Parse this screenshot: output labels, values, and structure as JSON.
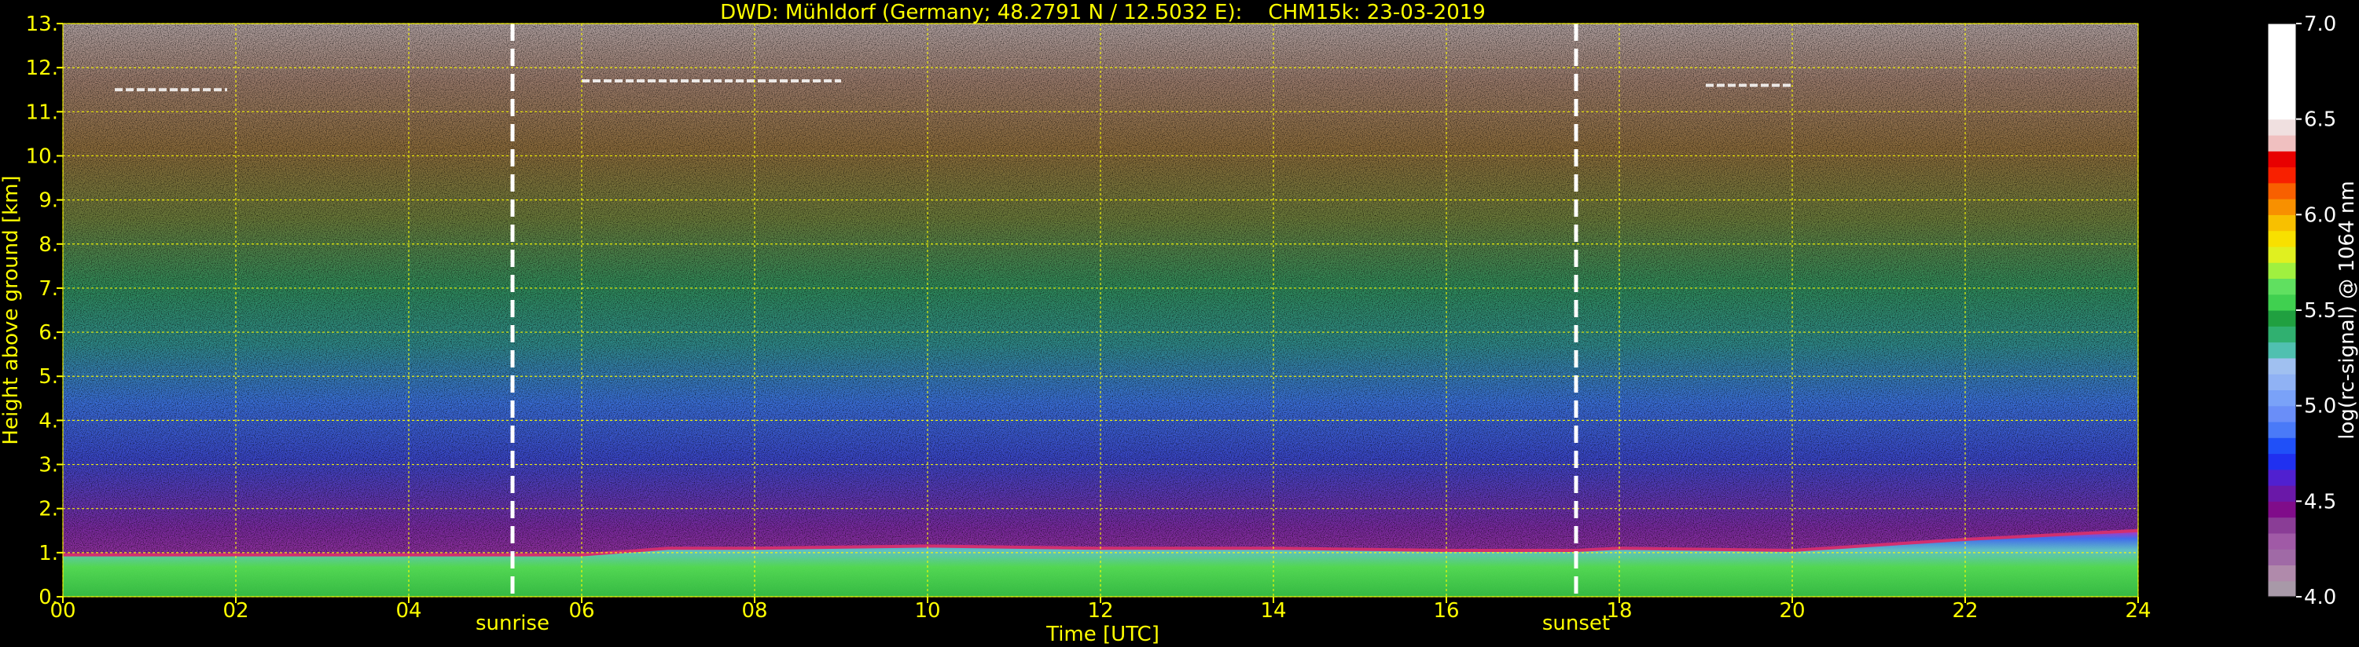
{
  "chart_data": {
    "type": "heatmap",
    "title": "DWD: Mühldorf (Germany; 48.2791 N / 12.5032 E):    CHM15k: 23-03-2019",
    "xlabel": "Time [UTC]",
    "ylabel": "Height above ground [km]",
    "xlim": [
      0,
      24
    ],
    "ylim": [
      0,
      13
    ],
    "x_ticks": [
      0,
      2,
      4,
      6,
      8,
      10,
      12,
      14,
      16,
      18,
      20,
      22,
      24
    ],
    "x_tick_labels": [
      "00",
      "02",
      "04",
      "06",
      "08",
      "10",
      "12",
      "14",
      "16",
      "18",
      "20",
      "22",
      "24"
    ],
    "y_ticks": [
      0,
      1,
      2,
      3,
      4,
      5,
      6,
      7,
      8,
      9,
      10,
      11,
      12,
      13
    ],
    "y_tick_labels": [
      "0.",
      "1.",
      "2.",
      "3.",
      "4.",
      "5.",
      "6.",
      "7.",
      "8.",
      "9.",
      "10.",
      "11.",
      "12.",
      "13."
    ],
    "grid": true,
    "events": [
      {
        "label": "sunrise",
        "time": 5.2
      },
      {
        "label": "sunset",
        "time": 17.5
      }
    ],
    "boundary_layer": [
      {
        "time": 0,
        "top": 0.95
      },
      {
        "time": 2,
        "top": 0.95
      },
      {
        "time": 4,
        "top": 0.95
      },
      {
        "time": 5.2,
        "top": 0.95
      },
      {
        "time": 6,
        "top": 0.95
      },
      {
        "time": 7,
        "top": 1.1
      },
      {
        "time": 8,
        "top": 1.1
      },
      {
        "time": 10,
        "top": 1.15
      },
      {
        "time": 12,
        "top": 1.1
      },
      {
        "time": 14,
        "top": 1.1
      },
      {
        "time": 16,
        "top": 1.05
      },
      {
        "time": 17.5,
        "top": 1.05
      },
      {
        "time": 18,
        "top": 1.1
      },
      {
        "time": 20,
        "top": 1.05
      },
      {
        "time": 22,
        "top": 1.3
      },
      {
        "time": 24,
        "top": 1.5
      }
    ],
    "cirrus": [
      {
        "start": 0.6,
        "end": 1.9,
        "height": 11.5
      },
      {
        "start": 6.0,
        "end": 9.0,
        "height": 11.7
      },
      {
        "start": 19.0,
        "end": 20.0,
        "height": 11.6
      }
    ],
    "colorbar": {
      "label": "log(rc-signal) @ 1064 nm",
      "min": 4.0,
      "max": 7.0,
      "ticks": [
        4.0,
        4.5,
        5.0,
        5.5,
        6.0,
        6.5,
        7.0
      ],
      "tick_labels": [
        "4.0",
        "4.5",
        "5.0",
        "5.5",
        "6.0",
        "6.5",
        "7.0"
      ],
      "colors": [
        "#a899a8",
        "#b08aab",
        "#a06aa6",
        "#a05aa6",
        "#8a3d96",
        "#800c8a",
        "#6a18a8",
        "#5020d0",
        "#2030f0",
        "#2050f8",
        "#4a7af8",
        "#6a8ef8",
        "#7aa2f8",
        "#90b2f4",
        "#a0c0f0",
        "#50c0b0",
        "#30b070",
        "#20a040",
        "#40d050",
        "#60e060",
        "#a0f040",
        "#e0f020",
        "#f8e000",
        "#f8c000",
        "#f89000",
        "#f86000",
        "#f82000",
        "#e80000",
        "#f0c0c0",
        "#f0e0e0",
        "#ffffff",
        "#ffffff",
        "#ffffff",
        "#ffffff",
        "#ffffff",
        "#ffffff"
      ]
    }
  }
}
